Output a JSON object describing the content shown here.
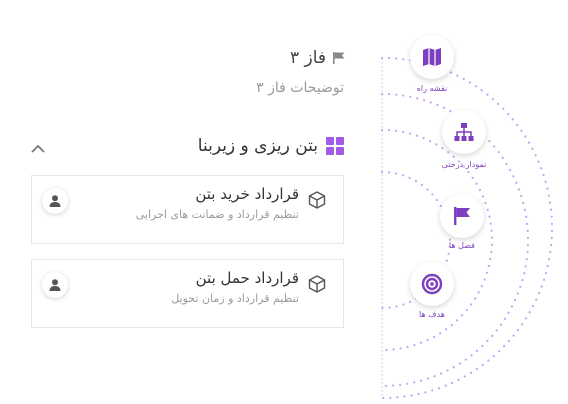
{
  "header": {
    "phase_title": "فاز ۳",
    "phase_description": "توضیحات فاز ۳"
  },
  "section": {
    "title": "بتن ریزی و زیربنا"
  },
  "cards": [
    {
      "title": "قرارداد خرید بتن",
      "subtitle": "تنظیم قرارداد و ضمانت های اجرایی"
    },
    {
      "title": "قرارداد حمل بتن",
      "subtitle": "تنظیم قرارداد و زمان تحویل"
    }
  ],
  "nav": [
    {
      "label": "نقشه راه",
      "icon": "map-icon"
    },
    {
      "label": "نمودار درختی",
      "icon": "org-chart-icon"
    },
    {
      "label": "فصل ها",
      "icon": "flag-icon"
    },
    {
      "label": "هدف ها",
      "icon": "target-icon"
    }
  ],
  "colors": {
    "accent": "#7b3fbf",
    "accent_light": "#a35ae8",
    "dots": "#c9a6f2"
  }
}
